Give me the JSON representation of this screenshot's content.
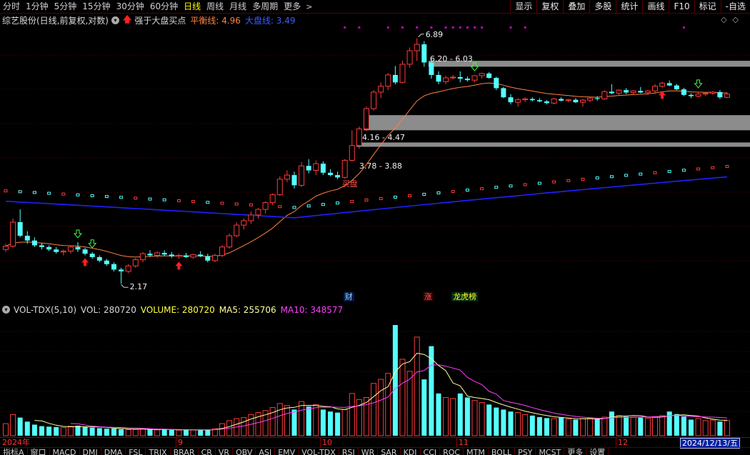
{
  "toolbar": {
    "periods": [
      "分时",
      "1分钟",
      "5分钟",
      "15分钟",
      "30分钟",
      "60分钟",
      "日线",
      "周线",
      "月线",
      "多周期",
      "更多"
    ],
    "active_period": "日线",
    "right_tools": [
      "显示",
      "复权",
      "叠加",
      "多股",
      "统计",
      "画线",
      "F10",
      "标记",
      "-自选"
    ]
  },
  "main": {
    "title": "综艺股份(日线,前复权,对数)",
    "formula": "强于大盘买点",
    "balance_label": "平衡线: 4.96",
    "big_label": "大盘线: 3.49",
    "price_labels": {
      "high": "6.89",
      "gap1": "6.20 - 6.03",
      "gap2": "4.16 - 4.47",
      "gap3": "3.78 - 3.88",
      "low": "2.17"
    },
    "buy_label": "买盘",
    "events": [
      "财",
      "涨",
      "龙虎榜"
    ]
  },
  "volume": {
    "name": "VOL-TDX(5,10)",
    "vol": "VOL: 280720",
    "volume": "VOLUME: 280720",
    "ma5": "MA5: 255706",
    "ma10": "MA10: 348577"
  },
  "date_axis": {
    "labels": [
      "2024年",
      "9",
      "10",
      "11",
      "12"
    ],
    "cursor": "2024/12/13/五"
  },
  "indicator_tabs": [
    "指标A",
    "窗口",
    "MACD",
    "DMI",
    "DMA",
    "FSL",
    "TRIX",
    "BRAR",
    "CR",
    "VR",
    "OBV",
    "ASI",
    "EMV",
    "VOL-TDX",
    "RSI",
    "WR",
    "SAR",
    "KDJ",
    "CCI",
    "ROC",
    "MTM",
    "BOLL",
    "PSY",
    "MCST",
    "更多",
    "设置"
  ],
  "colors": {
    "up": "#ff3a3a",
    "down": "#54ffff",
    "balance_line": "#ff8040",
    "big_line": "#2020ff",
    "ma5": "#ffffa0",
    "ma10": "#ff40ff"
  },
  "chart_data": {
    "type": "candlestick",
    "x": [
      "d01",
      "d02",
      "d03",
      "d04",
      "d05",
      "d06",
      "d07",
      "d08",
      "d09",
      "d10",
      "d11",
      "d12",
      "d13",
      "d14",
      "d15",
      "d16",
      "d17",
      "d18",
      "d19",
      "d20",
      "d21",
      "d22",
      "d23",
      "d24",
      "d25",
      "d26",
      "d27",
      "d28",
      "d29",
      "d30",
      "d31",
      "d32",
      "d33",
      "d34",
      "d35",
      "d36",
      "d37",
      "d38",
      "d39",
      "d40",
      "d41",
      "d42",
      "d43",
      "d44",
      "d45",
      "d46",
      "d47",
      "d48",
      "d49",
      "d50",
      "d51",
      "d52",
      "d53",
      "d54",
      "d55",
      "d56",
      "d57",
      "d58",
      "d59",
      "d60",
      "d61",
      "d62",
      "d63",
      "d64",
      "d65",
      "d66",
      "d67",
      "d68",
      "d69",
      "d70",
      "d71",
      "d72",
      "d73",
      "d74",
      "d75",
      "d76",
      "d77",
      "d78",
      "d79",
      "d80",
      "d81",
      "d82",
      "d83",
      "d84",
      "d85",
      "d86",
      "d87",
      "d88",
      "d89",
      "d90",
      "d91",
      "d92",
      "d93",
      "d94",
      "d95",
      "d96",
      "d97",
      "d98",
      "d99",
      "d100",
      "d101"
    ],
    "candles": [
      [
        2.55,
        2.62,
        2.52,
        2.59
      ],
      [
        2.59,
        2.95,
        2.57,
        2.9
      ],
      [
        2.9,
        3.08,
        2.7,
        2.72
      ],
      [
        2.72,
        2.78,
        2.62,
        2.66
      ],
      [
        2.66,
        2.7,
        2.58,
        2.6
      ],
      [
        2.6,
        2.63,
        2.55,
        2.58
      ],
      [
        2.58,
        2.6,
        2.53,
        2.55
      ],
      [
        2.55,
        2.58,
        2.5,
        2.52
      ],
      [
        2.52,
        2.55,
        2.48,
        2.53
      ],
      [
        2.53,
        2.6,
        2.5,
        2.58
      ],
      [
        2.58,
        2.64,
        2.52,
        2.55
      ],
      [
        2.55,
        2.57,
        2.48,
        2.5
      ],
      [
        2.5,
        2.52,
        2.44,
        2.46
      ],
      [
        2.46,
        2.48,
        2.4,
        2.42
      ],
      [
        2.42,
        2.44,
        2.36,
        2.38
      ],
      [
        2.38,
        2.4,
        2.3,
        2.32
      ],
      [
        2.32,
        2.34,
        2.17,
        2.3
      ],
      [
        2.3,
        2.38,
        2.28,
        2.36
      ],
      [
        2.36,
        2.45,
        2.34,
        2.43
      ],
      [
        2.43,
        2.52,
        2.4,
        2.5
      ],
      [
        2.5,
        2.54,
        2.46,
        2.48
      ],
      [
        2.48,
        2.53,
        2.45,
        2.51
      ],
      [
        2.51,
        2.54,
        2.47,
        2.49
      ],
      [
        2.49,
        2.52,
        2.45,
        2.47
      ],
      [
        2.47,
        2.5,
        2.44,
        2.48
      ],
      [
        2.48,
        2.51,
        2.45,
        2.46
      ],
      [
        2.46,
        2.5,
        2.44,
        2.49
      ],
      [
        2.49,
        2.53,
        2.46,
        2.47
      ],
      [
        2.47,
        2.5,
        2.4,
        2.42
      ],
      [
        2.42,
        2.5,
        2.4,
        2.48
      ],
      [
        2.48,
        2.6,
        2.46,
        2.58
      ],
      [
        2.58,
        2.75,
        2.56,
        2.72
      ],
      [
        2.72,
        2.9,
        2.7,
        2.86
      ],
      [
        2.86,
        2.95,
        2.8,
        2.92
      ],
      [
        2.92,
        3.05,
        2.88,
        3.0
      ],
      [
        3.0,
        3.1,
        2.95,
        3.08
      ],
      [
        3.08,
        3.2,
        3.02,
        3.18
      ],
      [
        3.18,
        3.32,
        3.14,
        3.3
      ],
      [
        3.3,
        3.6,
        3.28,
        3.55
      ],
      [
        3.55,
        3.7,
        3.5,
        3.62
      ],
      [
        3.62,
        3.68,
        3.4,
        3.45
      ],
      [
        3.45,
        3.85,
        3.42,
        3.78
      ],
      [
        3.78,
        3.9,
        3.65,
        3.7
      ],
      [
        3.7,
        3.88,
        3.62,
        3.82
      ],
      [
        3.82,
        3.86,
        3.62,
        3.66
      ],
      [
        3.66,
        3.72,
        3.6,
        3.62
      ],
      [
        3.62,
        3.68,
        3.55,
        3.58
      ],
      [
        3.58,
        3.9,
        3.56,
        3.88
      ],
      [
        3.88,
        4.47,
        3.86,
        4.16
      ],
      [
        4.16,
        4.55,
        4.1,
        4.5
      ],
      [
        4.5,
        5.0,
        4.45,
        4.95
      ],
      [
        4.95,
        5.4,
        4.9,
        5.35
      ],
      [
        5.35,
        5.6,
        5.2,
        5.5
      ],
      [
        5.5,
        5.85,
        5.4,
        5.8
      ],
      [
        5.8,
        6.05,
        5.55,
        5.6
      ],
      [
        5.6,
        6.2,
        5.58,
        6.1
      ],
      [
        6.1,
        6.6,
        6.0,
        6.5
      ],
      [
        6.5,
        6.89,
        6.2,
        6.7
      ],
      [
        6.7,
        6.8,
        6.03,
        6.15
      ],
      [
        6.15,
        6.25,
        5.7,
        5.8
      ],
      [
        5.8,
        5.9,
        5.55,
        5.62
      ],
      [
        5.62,
        5.78,
        5.55,
        5.72
      ],
      [
        5.72,
        5.8,
        5.68,
        5.74
      ],
      [
        5.74,
        5.9,
        5.6,
        5.7
      ],
      [
        5.7,
        5.76,
        5.62,
        5.66
      ],
      [
        5.66,
        5.8,
        5.6,
        5.78
      ],
      [
        5.78,
        5.86,
        5.7,
        5.84
      ],
      [
        5.84,
        5.88,
        5.7,
        5.72
      ],
      [
        5.72,
        5.75,
        5.4,
        5.45
      ],
      [
        5.45,
        5.48,
        5.2,
        5.22
      ],
      [
        5.22,
        5.3,
        5.05,
        5.1
      ],
      [
        5.1,
        5.2,
        5.0,
        5.16
      ],
      [
        5.16,
        5.22,
        5.1,
        5.18
      ],
      [
        5.18,
        5.22,
        5.12,
        5.15
      ],
      [
        5.15,
        5.2,
        5.1,
        5.12
      ],
      [
        5.12,
        5.15,
        5.05,
        5.08
      ],
      [
        5.08,
        5.2,
        5.05,
        5.18
      ],
      [
        5.18,
        5.22,
        5.12,
        5.14
      ],
      [
        5.14,
        5.18,
        5.1,
        5.16
      ],
      [
        5.16,
        5.2,
        5.08,
        5.1
      ],
      [
        5.1,
        5.18,
        5.0,
        5.15
      ],
      [
        5.15,
        5.22,
        5.1,
        5.2
      ],
      [
        5.2,
        5.25,
        5.14,
        5.18
      ],
      [
        5.18,
        5.4,
        5.16,
        5.36
      ],
      [
        5.36,
        5.55,
        5.3,
        5.32
      ],
      [
        5.32,
        5.42,
        5.28,
        5.4
      ],
      [
        5.4,
        5.45,
        5.3,
        5.34
      ],
      [
        5.34,
        5.4,
        5.28,
        5.38
      ],
      [
        5.38,
        5.48,
        5.32,
        5.34
      ],
      [
        5.34,
        5.4,
        5.28,
        5.38
      ],
      [
        5.38,
        5.55,
        5.3,
        5.5
      ],
      [
        5.5,
        5.62,
        5.45,
        5.58
      ],
      [
        5.58,
        5.65,
        5.5,
        5.52
      ],
      [
        5.52,
        5.56,
        5.4,
        5.42
      ],
      [
        5.42,
        5.46,
        5.25,
        5.28
      ],
      [
        5.28,
        5.32,
        5.2,
        5.25
      ],
      [
        5.25,
        5.35,
        5.22,
        5.3
      ],
      [
        5.3,
        5.34,
        5.25,
        5.32
      ],
      [
        5.32,
        5.38,
        5.28,
        5.35
      ],
      [
        5.35,
        5.4,
        5.18,
        5.22
      ],
      [
        5.22,
        5.35,
        5.2,
        5.3
      ]
    ],
    "volume": [
      120,
      210,
      180,
      140,
      110,
      95,
      90,
      85,
      80,
      95,
      100,
      85,
      80,
      75,
      70,
      72,
      65,
      60,
      62,
      68,
      60,
      58,
      62,
      58,
      56,
      60,
      58,
      55,
      60,
      70,
      120,
      150,
      170,
      180,
      210,
      230,
      250,
      280,
      320,
      300,
      260,
      340,
      290,
      310,
      260,
      240,
      230,
      260,
      420,
      360,
      380,
      520,
      560,
      620,
      1100,
      760,
      640,
      980,
      560,
      890,
      420,
      380,
      370,
      420,
      380,
      350,
      330,
      310,
      280,
      260,
      240,
      230,
      210,
      200,
      185,
      175,
      170,
      180,
      165,
      160,
      170,
      175,
      165,
      185,
      240,
      200,
      190,
      185,
      180,
      175,
      190,
      200,
      240,
      215,
      190,
      160,
      170,
      150,
      155,
      140,
      150
    ],
    "ylim": [
      2.1,
      7.0
    ]
  }
}
